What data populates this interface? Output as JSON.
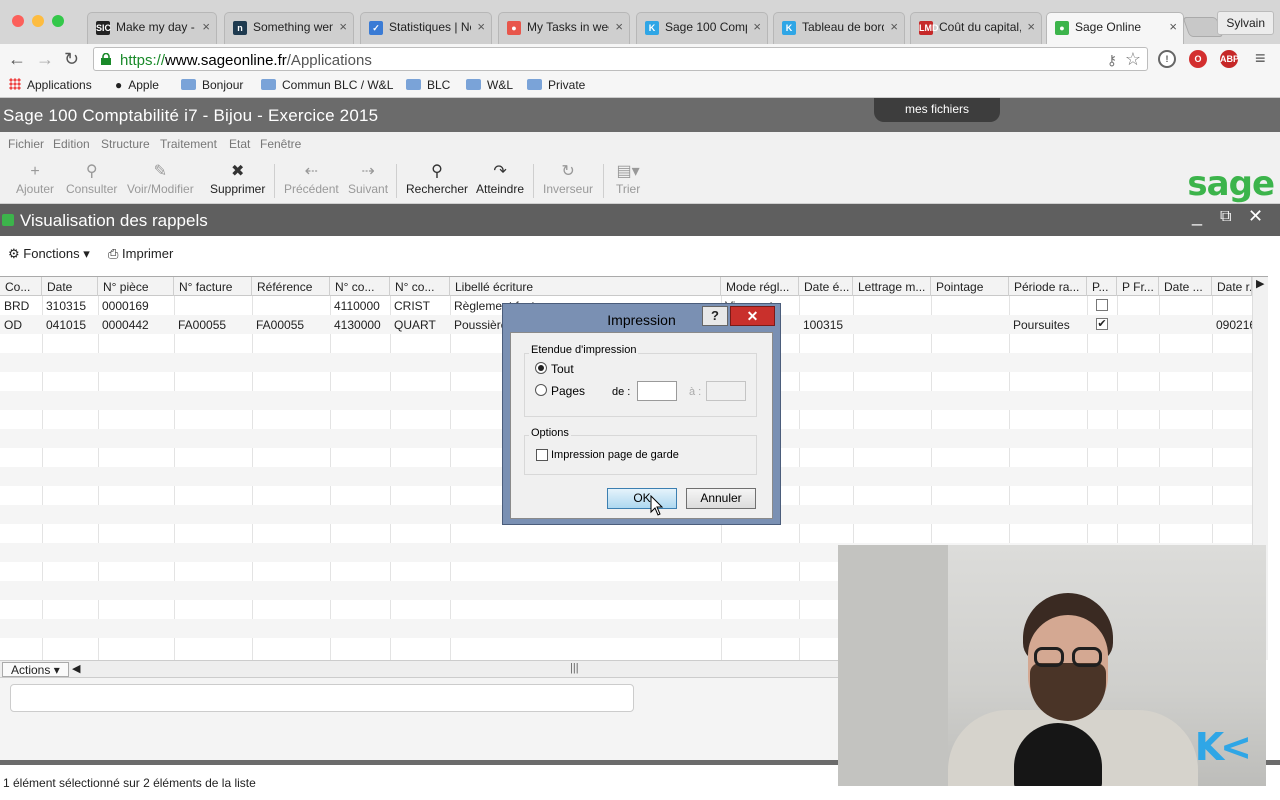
{
  "browser": {
    "tabs": [
      {
        "title": "Make my day - F",
        "favicon": "SIC",
        "color": "#222222"
      },
      {
        "title": "Something went",
        "favicon": "n",
        "color": "#1e3a4f"
      },
      {
        "title": "Statistiques | Ne",
        "favicon": "✓",
        "color": "#3a7bd5"
      },
      {
        "title": "My Tasks in wee",
        "favicon": "●",
        "color": "#e8564b"
      },
      {
        "title": "Sage 100 Comp",
        "favicon": "K",
        "color": "#2fa6e6"
      },
      {
        "title": "Tableau de bord",
        "favicon": "K",
        "color": "#2fa6e6"
      },
      {
        "title": "Coût du capital,",
        "favicon": "LMD",
        "color": "#c62828"
      },
      {
        "title": "Sage Online",
        "favicon": "●",
        "color": "#3cb44b"
      }
    ],
    "profile": "Sylvain",
    "url": {
      "scheme": "https://",
      "host": "www.sageonline.fr",
      "path": "/Applications"
    },
    "bookmarks": [
      "Applications",
      "Apple",
      "Bonjour",
      "Commun BLC / W&L",
      "BLC",
      "W&L",
      "Private"
    ],
    "extensions": {
      "abp": "ABP"
    }
  },
  "app": {
    "title": "Sage 100 Comptabilité i7 - Bijou - Exercice 2015",
    "my_files": "mes fichiers",
    "menu": [
      "Fichier",
      "Edition",
      "Structure",
      "Traitement",
      "Etat",
      "Fenêtre"
    ],
    "toolbar": {
      "add": "Ajouter",
      "view": "Consulter",
      "edit": "Voir/Modifier",
      "delete": "Supprimer",
      "prev": "Précédent",
      "next": "Suivant",
      "search": "Rechercher",
      "goto": "Atteindre",
      "invert": "Inverseur",
      "sort": "Trier"
    },
    "logo": "sage",
    "window_title": "Visualisation des rappels",
    "functions": "Fonctions",
    "print": "Imprimer",
    "columns": [
      "Co...",
      "Date",
      "N° pièce",
      "N° facture",
      "Référence",
      "N° co...",
      "N° co...",
      "Libellé écriture",
      "Mode régl...",
      "Date é...",
      "Lettrage m...",
      "Pointage",
      "Période ra...",
      "P...",
      "P Fr...",
      "Date ...",
      "Date r..."
    ],
    "rows": [
      {
        "code": "BRD",
        "date": "310315",
        "piece": "0000169",
        "invoice": "",
        "ref": "",
        "acc1": "4110000",
        "acc2": "CRIST",
        "label": "Règlement facture",
        "mode": "Virement",
        "due": "",
        "letter": "",
        "point": "",
        "period": "",
        "p": false,
        "last": ""
      },
      {
        "code": "OD",
        "date": "041015",
        "piece": "0000442",
        "invoice": "FA00055",
        "ref": "FA00055",
        "acc1": "4130000",
        "acc2": "QUART",
        "label": "Poussière",
        "mode": "",
        "due": "100315",
        "letter": "",
        "point": "",
        "period": "Poursuites",
        "p": true,
        "last": "090216"
      }
    ],
    "actions": "Actions",
    "status": "1 élément sélectionné sur 2 éléments de la liste"
  },
  "dialog": {
    "title": "Impression",
    "help": "?",
    "scope_group": "Etendue d'impression",
    "all": "Tout",
    "pages": "Pages",
    "from": "de :",
    "to": "à :",
    "options_group": "Options",
    "cover_page": "Impression page de garde",
    "ok": "OK",
    "cancel": "Annuler"
  }
}
